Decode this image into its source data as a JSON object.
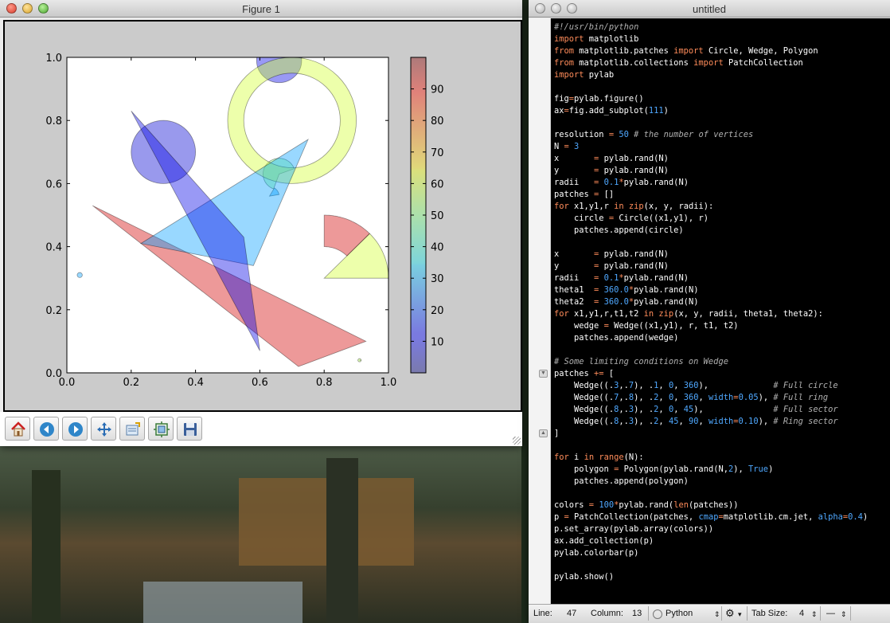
{
  "figure_window": {
    "title": "Figure 1",
    "toolbar": [
      {
        "name": "home-button",
        "icon": "home-icon"
      },
      {
        "name": "back-button",
        "icon": "back-arrow-icon"
      },
      {
        "name": "forward-button",
        "icon": "forward-arrow-icon"
      },
      {
        "name": "pan-button",
        "icon": "pan-arrows-icon"
      },
      {
        "name": "zoom-rect-button",
        "icon": "zoom-rect-icon"
      },
      {
        "name": "subplots-button",
        "icon": "subplots-icon"
      },
      {
        "name": "save-button",
        "icon": "floppy-disk-icon"
      }
    ]
  },
  "chart_data": {
    "type": "scatter",
    "title": "",
    "xlabel": "",
    "ylabel": "",
    "xlim": [
      0.0,
      1.0
    ],
    "ylim": [
      0.0,
      1.0
    ],
    "x_ticks": [
      "0.0",
      "0.2",
      "0.4",
      "0.6",
      "0.8",
      "1.0"
    ],
    "y_ticks": [
      "0.0",
      "0.2",
      "0.4",
      "0.6",
      "0.8",
      "1.0"
    ],
    "colorbar": {
      "vmin": 0,
      "vmax": 100,
      "ticks": [
        "10",
        "20",
        "30",
        "40",
        "50",
        "60",
        "70",
        "80",
        "90"
      ],
      "cmap": "jet",
      "alpha": 0.4
    },
    "patches": [
      {
        "kind": "circle",
        "center": [
          0.3,
          0.7
        ],
        "r": 0.1,
        "value": 8
      },
      {
        "kind": "circle",
        "center": [
          0.66,
          0.99
        ],
        "r": 0.07,
        "value": 10
      },
      {
        "kind": "circle",
        "center": [
          0.04,
          0.31
        ],
        "r": 0.008,
        "value": 28
      },
      {
        "kind": "wedge",
        "center": [
          0.66,
          0.63
        ],
        "r": 0.05,
        "theta1": 20,
        "theta2": 250,
        "value": 50
      },
      {
        "kind": "wedge",
        "center": [
          0.63,
          0.56
        ],
        "r": 0.03,
        "theta1": 10,
        "theta2": 60,
        "value": 28
      },
      {
        "kind": "wedge",
        "center": [
          0.91,
          0.04
        ],
        "r": 0.005,
        "theta1": 0,
        "theta2": 360,
        "value": 55
      },
      {
        "kind": "ring",
        "center": [
          0.7,
          0.8
        ],
        "r": 0.2,
        "width": 0.05,
        "value": 58
      },
      {
        "kind": "wedge",
        "center": [
          0.8,
          0.3
        ],
        "r": 0.2,
        "theta1": 0,
        "theta2": 45,
        "value": 58
      },
      {
        "kind": "wedge",
        "center": [
          0.8,
          0.3
        ],
        "r": 0.2,
        "theta1": 45,
        "theta2": 90,
        "width": 0.1,
        "value": 92
      },
      {
        "kind": "polygon",
        "points": [
          [
            0.08,
            0.53
          ],
          [
            0.93,
            0.1
          ],
          [
            0.72,
            0.02
          ]
        ],
        "value": 92
      },
      {
        "kind": "polygon",
        "points": [
          [
            0.23,
            0.41
          ],
          [
            0.75,
            0.74
          ],
          [
            0.58,
            0.34
          ]
        ],
        "value": 28
      },
      {
        "kind": "polygon",
        "points": [
          [
            0.2,
            0.83
          ],
          [
            0.55,
            0.43
          ],
          [
            0.6,
            0.07
          ]
        ],
        "value": 10
      }
    ]
  },
  "editor_window": {
    "title": "untitled",
    "code_lines": [
      [
        [
          "cm",
          "#!/usr/bin/python"
        ]
      ],
      [
        [
          "kw",
          "import"
        ],
        [
          "",
          " matplotlib"
        ]
      ],
      [
        [
          "kw",
          "from"
        ],
        [
          "",
          " matplotlib.patches "
        ],
        [
          "kw",
          "import"
        ],
        [
          "",
          " Circle, Wedge, Polygon"
        ]
      ],
      [
        [
          "kw",
          "from"
        ],
        [
          "",
          " matplotlib.collections "
        ],
        [
          "kw",
          "import"
        ],
        [
          "",
          " PatchCollection"
        ]
      ],
      [
        [
          "kw",
          "import"
        ],
        [
          "",
          " pylab"
        ]
      ],
      [
        [
          "",
          ""
        ]
      ],
      [
        [
          "",
          "fig"
        ],
        [
          "op",
          "="
        ],
        [
          "",
          "pylab.figure()"
        ]
      ],
      [
        [
          "",
          "ax"
        ],
        [
          "op",
          "="
        ],
        [
          "",
          "fig.add_subplot("
        ],
        [
          "nm",
          "111"
        ],
        [
          "",
          ")"
        ]
      ],
      [
        [
          "",
          ""
        ]
      ],
      [
        [
          "",
          "resolution "
        ],
        [
          "op",
          "="
        ],
        [
          "",
          " "
        ],
        [
          "nm",
          "50"
        ],
        [
          "",
          " "
        ],
        [
          "cm",
          "# the number of vertices"
        ]
      ],
      [
        [
          "",
          "N "
        ],
        [
          "op",
          "="
        ],
        [
          "",
          " "
        ],
        [
          "nm",
          "3"
        ]
      ],
      [
        [
          "",
          "x       "
        ],
        [
          "op",
          "="
        ],
        [
          "",
          " pylab.rand(N)"
        ]
      ],
      [
        [
          "",
          "y       "
        ],
        [
          "op",
          "="
        ],
        [
          "",
          " pylab.rand(N)"
        ]
      ],
      [
        [
          "",
          "radii   "
        ],
        [
          "op",
          "="
        ],
        [
          "",
          " "
        ],
        [
          "nm",
          "0.1"
        ],
        [
          "op",
          "*"
        ],
        [
          "",
          "pylab.rand(N)"
        ]
      ],
      [
        [
          "",
          "patches "
        ],
        [
          "op",
          "="
        ],
        [
          "",
          " []"
        ]
      ],
      [
        [
          "kw",
          "for"
        ],
        [
          "",
          " x1,y1,r "
        ],
        [
          "kw",
          "in"
        ],
        [
          "",
          " "
        ],
        [
          "kw",
          "zip"
        ],
        [
          "",
          "(x, y, radii):"
        ]
      ],
      [
        [
          "",
          "    circle "
        ],
        [
          "op",
          "="
        ],
        [
          "",
          " Circle((x1,y1), r)"
        ]
      ],
      [
        [
          "",
          "    patches.append(circle)"
        ]
      ],
      [
        [
          "",
          ""
        ]
      ],
      [
        [
          "",
          "x       "
        ],
        [
          "op",
          "="
        ],
        [
          "",
          " pylab.rand(N)"
        ]
      ],
      [
        [
          "",
          "y       "
        ],
        [
          "op",
          "="
        ],
        [
          "",
          " pylab.rand(N)"
        ]
      ],
      [
        [
          "",
          "radii   "
        ],
        [
          "op",
          "="
        ],
        [
          "",
          " "
        ],
        [
          "nm",
          "0.1"
        ],
        [
          "op",
          "*"
        ],
        [
          "",
          "pylab.rand(N)"
        ]
      ],
      [
        [
          "",
          "theta1  "
        ],
        [
          "op",
          "="
        ],
        [
          "",
          " "
        ],
        [
          "nm",
          "360.0"
        ],
        [
          "op",
          "*"
        ],
        [
          "",
          "pylab.rand(N)"
        ]
      ],
      [
        [
          "",
          "theta2  "
        ],
        [
          "op",
          "="
        ],
        [
          "",
          " "
        ],
        [
          "nm",
          "360.0"
        ],
        [
          "op",
          "*"
        ],
        [
          "",
          "pylab.rand(N)"
        ]
      ],
      [
        [
          "kw",
          "for"
        ],
        [
          "",
          " x1,y1,r,t1,t2 "
        ],
        [
          "kw",
          "in"
        ],
        [
          "",
          " "
        ],
        [
          "kw",
          "zip"
        ],
        [
          "",
          "(x, y, radii, theta1, theta2):"
        ]
      ],
      [
        [
          "",
          "    wedge "
        ],
        [
          "op",
          "="
        ],
        [
          "",
          " Wedge((x1,y1), r, t1, t2)"
        ]
      ],
      [
        [
          "",
          "    patches.append(wedge)"
        ]
      ],
      [
        [
          "",
          ""
        ]
      ],
      [
        [
          "cm",
          "# Some limiting conditions on Wedge"
        ]
      ],
      [
        [
          "",
          "patches "
        ],
        [
          "op",
          "+="
        ],
        [
          "",
          " ["
        ]
      ],
      [
        [
          "",
          "    Wedge((."
        ],
        [
          "nm",
          "3"
        ],
        [
          "",
          ",."
        ],
        [
          "nm",
          "7"
        ],
        [
          "",
          "), ."
        ],
        [
          "nm",
          "1"
        ],
        [
          "",
          ", "
        ],
        [
          "nm",
          "0"
        ],
        [
          "",
          ", "
        ],
        [
          "nm",
          "360"
        ],
        [
          "",
          "),             "
        ],
        [
          "cm",
          "# Full circle"
        ]
      ],
      [
        [
          "",
          "    Wedge((."
        ],
        [
          "nm",
          "7"
        ],
        [
          "",
          ",."
        ],
        [
          "nm",
          "8"
        ],
        [
          "",
          "), ."
        ],
        [
          "nm",
          "2"
        ],
        [
          "",
          ", "
        ],
        [
          "nm",
          "0"
        ],
        [
          "",
          ", "
        ],
        [
          "nm",
          "360"
        ],
        [
          "",
          ", "
        ],
        [
          "nm",
          "width"
        ],
        [
          "op",
          "="
        ],
        [
          "nm",
          "0.05"
        ],
        [
          "",
          "), "
        ],
        [
          "cm",
          "# Full ring"
        ]
      ],
      [
        [
          "",
          "    Wedge((."
        ],
        [
          "nm",
          "8"
        ],
        [
          "",
          ",."
        ],
        [
          "nm",
          "3"
        ],
        [
          "",
          "), ."
        ],
        [
          "nm",
          "2"
        ],
        [
          "",
          ", "
        ],
        [
          "nm",
          "0"
        ],
        [
          "",
          ", "
        ],
        [
          "nm",
          "45"
        ],
        [
          "",
          "),              "
        ],
        [
          "cm",
          "# Full sector"
        ]
      ],
      [
        [
          "",
          "    Wedge((."
        ],
        [
          "nm",
          "8"
        ],
        [
          "",
          ",."
        ],
        [
          "nm",
          "3"
        ],
        [
          "",
          "), ."
        ],
        [
          "nm",
          "2"
        ],
        [
          "",
          ", "
        ],
        [
          "nm",
          "45"
        ],
        [
          "",
          ", "
        ],
        [
          "nm",
          "90"
        ],
        [
          "",
          ", "
        ],
        [
          "nm",
          "width"
        ],
        [
          "op",
          "="
        ],
        [
          "nm",
          "0.10"
        ],
        [
          "",
          "), "
        ],
        [
          "cm",
          "# Ring sector"
        ]
      ],
      [
        [
          "",
          "]"
        ]
      ],
      [
        [
          "",
          ""
        ]
      ],
      [
        [
          "kw",
          "for"
        ],
        [
          "",
          " i "
        ],
        [
          "kw",
          "in"
        ],
        [
          "",
          " "
        ],
        [
          "kw",
          "range"
        ],
        [
          "",
          "(N):"
        ]
      ],
      [
        [
          "",
          "    polygon "
        ],
        [
          "op",
          "="
        ],
        [
          "",
          " Polygon(pylab.rand(N,"
        ],
        [
          "nm",
          "2"
        ],
        [
          "",
          "), "
        ],
        [
          "nm",
          "True"
        ],
        [
          "",
          ")"
        ]
      ],
      [
        [
          "",
          "    patches.append(polygon)"
        ]
      ],
      [
        [
          "",
          ""
        ]
      ],
      [
        [
          "",
          "colors "
        ],
        [
          "op",
          "="
        ],
        [
          "",
          " "
        ],
        [
          "nm",
          "100"
        ],
        [
          "op",
          "*"
        ],
        [
          "",
          "pylab.rand("
        ],
        [
          "kw",
          "len"
        ],
        [
          "",
          "(patches))"
        ]
      ],
      [
        [
          "",
          "p "
        ],
        [
          "op",
          "="
        ],
        [
          "",
          " PatchCollection(patches, "
        ],
        [
          "nm",
          "cmap"
        ],
        [
          "op",
          "="
        ],
        [
          "",
          "matplotlib.cm.jet, "
        ],
        [
          "nm",
          "alpha"
        ],
        [
          "op",
          "="
        ],
        [
          "nm",
          "0.4"
        ],
        [
          "",
          ")"
        ]
      ],
      [
        [
          "",
          "p.set_array(pylab.array(colors))"
        ]
      ],
      [
        [
          "",
          "ax.add_collection(p)"
        ]
      ],
      [
        [
          "",
          "pylab.colorbar(p)"
        ]
      ],
      [
        [
          "",
          ""
        ]
      ],
      [
        [
          "",
          "pylab.show()"
        ]
      ]
    ],
    "status": {
      "line_label": "Line:",
      "line_value": "47",
      "column_label": "Column:",
      "column_value": "13",
      "language": "Python",
      "tab_size_label": "Tab Size:",
      "tab_size_value": "4",
      "symbol_value": "—"
    }
  }
}
